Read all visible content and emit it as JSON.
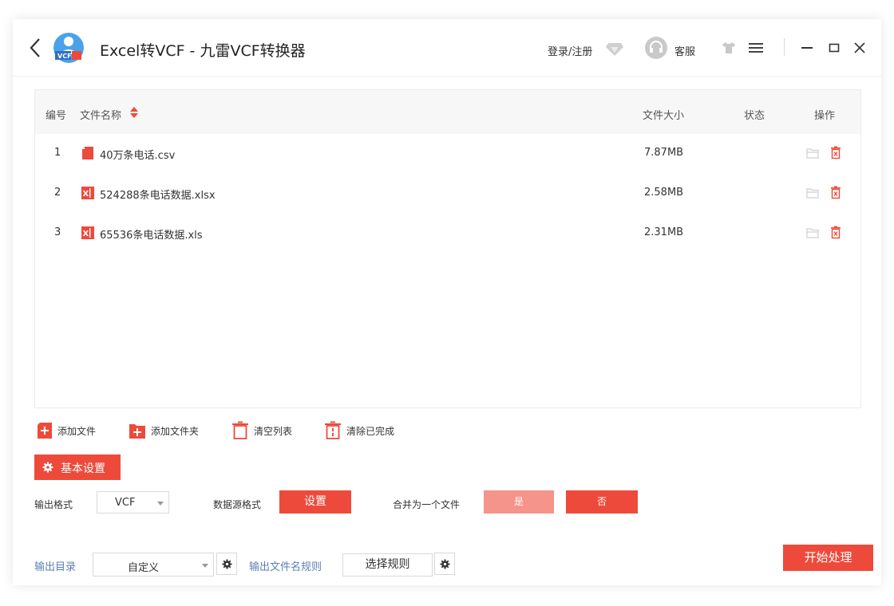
{
  "titlebar": {
    "title": "Excel转VCF - 九雷VCF转换器",
    "login": "登录/注册",
    "service": "客服"
  },
  "table": {
    "headers": {
      "index": "编号",
      "name": "文件名称",
      "size": "文件大小",
      "status": "状态",
      "actions": "操作"
    },
    "rows": [
      {
        "index": "1",
        "name": "40万条电话.csv",
        "size": "7.87MB",
        "status": "",
        "type": "csv"
      },
      {
        "index": "2",
        "name": "524288条电话数据.xlsx",
        "size": "2.58MB",
        "status": "",
        "type": "excel"
      },
      {
        "index": "3",
        "name": "65536条电话数据.xls",
        "size": "2.31MB",
        "status": "",
        "type": "excel"
      }
    ]
  },
  "actions": {
    "add_file": "添加文件",
    "add_folder": "添加文件夹",
    "clear_list": "清空列表",
    "clear_done": "清除已完成"
  },
  "settings": {
    "header": "基本设置",
    "output_format_label": "输出格式",
    "output_format_value": "VCF",
    "source_format_label": "数据源格式",
    "source_format_button": "设置",
    "merge_label": "合并为一个文件",
    "merge_yes": "是",
    "merge_no": "否",
    "output_dir_label": "输出目录",
    "output_dir_value": "自定义",
    "filename_rule_label": "输出文件名规则",
    "filename_rule_button": "选择规则",
    "start_button": "开始处理"
  },
  "colors": {
    "accent": "#ee4a3b",
    "accent_light": "#f4948a",
    "link": "#5b7fb3"
  }
}
